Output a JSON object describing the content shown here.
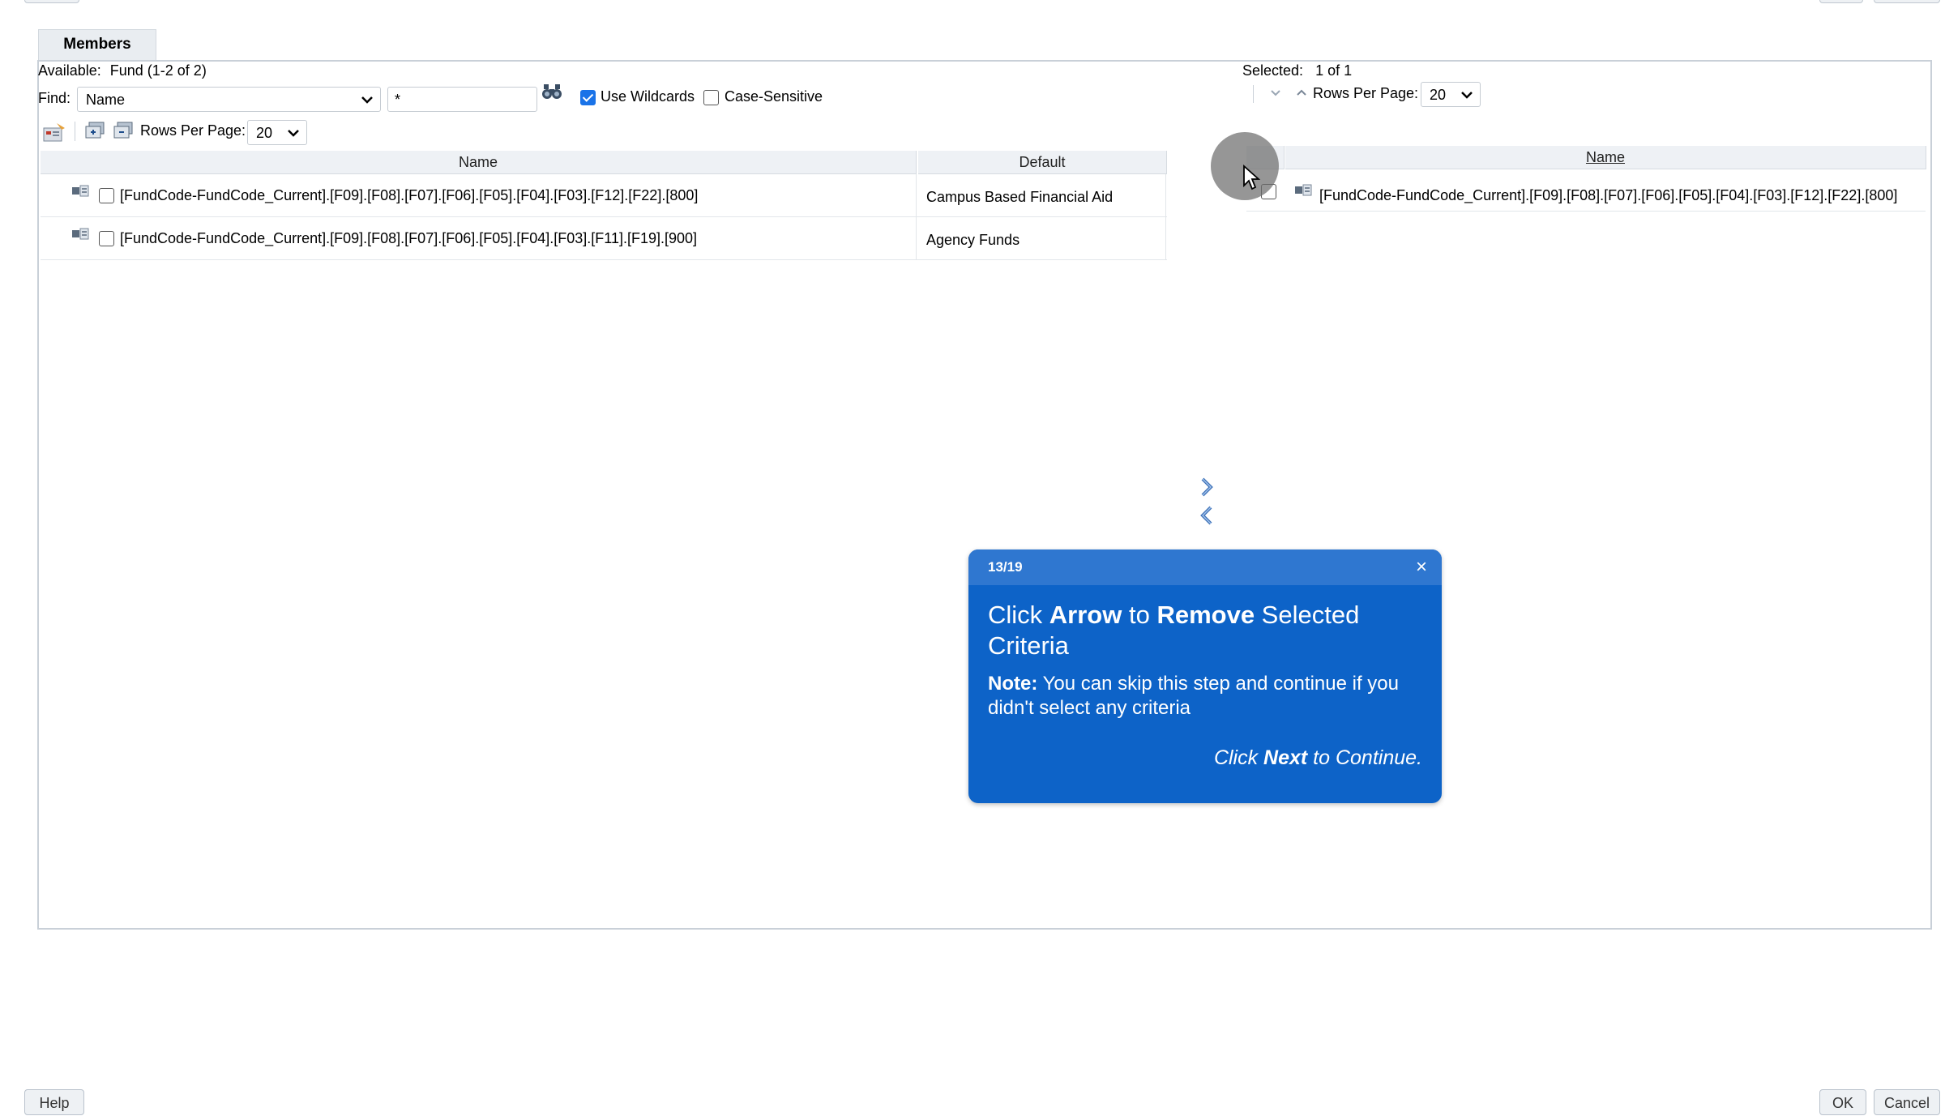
{
  "tab": {
    "label": "Members"
  },
  "available": {
    "label": "Available:",
    "value": "Fund (1-2 of 2)",
    "find_label": "Find:",
    "find_by": "Name",
    "search_value": "*",
    "use_wildcards": "Use Wildcards",
    "case_sensitive": "Case-Sensitive",
    "rows_per_page_label": "Rows Per Page:",
    "rows_per_page": "20",
    "columns": [
      "Name",
      "Default"
    ],
    "rows": [
      {
        "name": "[FundCode-FundCode_Current].[F09].[F08].[F07].[F06].[F05].[F04].[F03].[F12].[F22].[800]",
        "default": "Campus Based Financial Aid"
      },
      {
        "name": "[FundCode-FundCode_Current].[F09].[F08].[F07].[F06].[F05].[F04].[F03].[F11].[F19].[900]",
        "default": "Agency Funds"
      }
    ]
  },
  "selected": {
    "label": "Selected:",
    "value": "1 of 1",
    "rows_per_page_label": "Rows Per Page:",
    "rows_per_page": "20",
    "column": "Name",
    "rows": [
      {
        "name": "[FundCode-FundCode_Current].[F09].[F08].[F07].[F06].[F05].[F04].[F03].[F12].[F22].[800]"
      }
    ]
  },
  "tour": {
    "step": "13/19",
    "close": "×",
    "title_1": "Click ",
    "title_b1": "Arrow",
    "title_2": " to ",
    "title_b2": "Remove",
    "title_3": " Selected Criteria",
    "note_b": "Note:",
    "note": " You can skip this step and continue if you didn't select any criteria",
    "foot_1": "Click ",
    "foot_b": "Next",
    "foot_2": " to Continue."
  },
  "buttons": {
    "help": "Help",
    "ok": "OK",
    "cancel": "Cancel"
  },
  "colors": {
    "tour_bg": "#0d63c8",
    "tour_header": "#2f77d0",
    "accent": "#1a73e8"
  }
}
